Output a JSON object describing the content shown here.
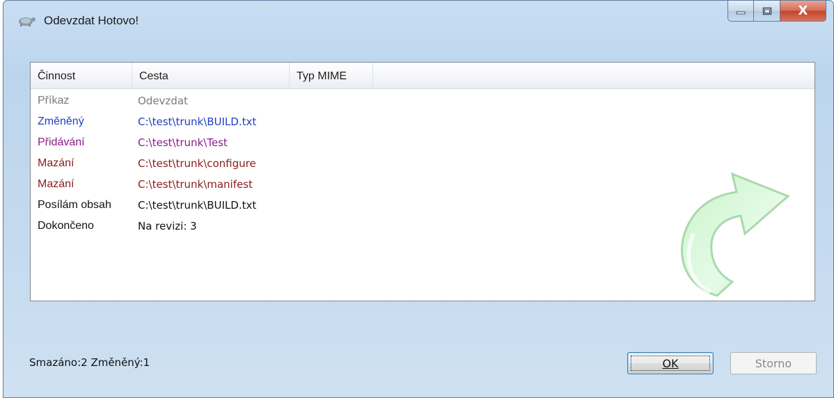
{
  "window": {
    "title": "Odevzdat Hotovo!",
    "close_glyph": "X"
  },
  "columns": [
    "Činnost",
    "Cesta",
    "Typ MIME"
  ],
  "rows": [
    {
      "action": "Příkaz",
      "path": "Odevzdat",
      "color": "#7a7a7a"
    },
    {
      "action": "Změněný",
      "path": "C:\\test\\trunk\\BUILD.txt",
      "color": "#1f3fbf"
    },
    {
      "action": "Přidávání",
      "path": "C:\\test\\trunk\\Test",
      "color": "#8a1a8a"
    },
    {
      "action": "Mazání",
      "path": "C:\\test\\trunk\\configure",
      "color": "#8b1a1a"
    },
    {
      "action": "Mazání",
      "path": "C:\\test\\trunk\\manifest",
      "color": "#8b1a1a"
    },
    {
      "action": "Posílám obsah",
      "path": "C:\\test\\trunk\\BUILD.txt",
      "color": "#111111"
    },
    {
      "action": "Dokončeno",
      "path": "Na revizi: 3",
      "color": "#111111"
    }
  ],
  "status": "Smazáno:2 Změněný:1",
  "buttons": {
    "ok": "OK",
    "cancel": "Storno"
  },
  "icons": {
    "app": "tortoise-icon",
    "minimize": "minimize-icon",
    "maximize": "maximize-icon",
    "close": "close-icon",
    "watermark": "commit-arrow-icon"
  }
}
